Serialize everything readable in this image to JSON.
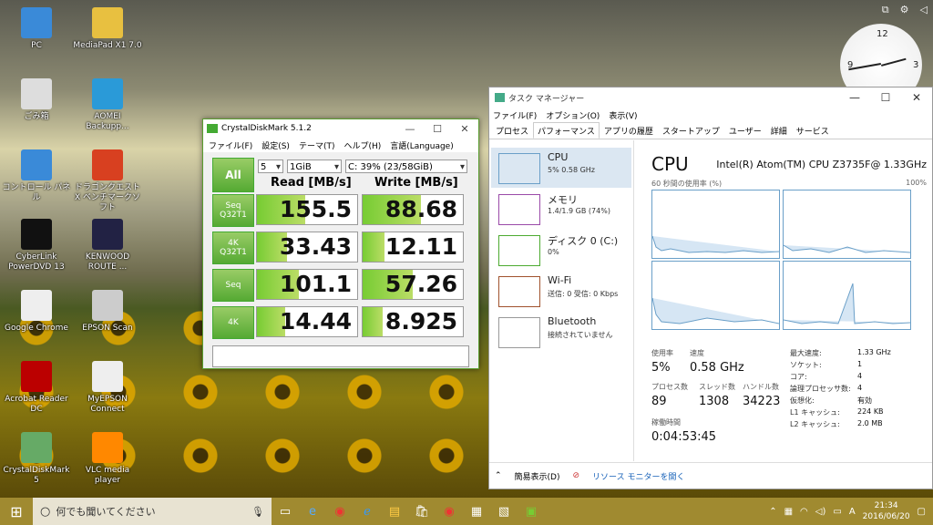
{
  "desktop": {
    "icons": [
      {
        "label": "PC",
        "icon": "computer-icon"
      },
      {
        "label": "MediaPad X1 7.0",
        "icon": "folder-icon"
      },
      {
        "label": "ごみ箱",
        "icon": "recycle-bin-icon"
      },
      {
        "label": "AOMEI Backupp...",
        "icon": "aomei-icon"
      },
      {
        "label": "コントロール パネル",
        "icon": "control-panel-icon"
      },
      {
        "label": "ドラゴンクエストX ベンチマークソフト",
        "icon": "dq-icon"
      },
      {
        "label": "CyberLink PowerDVD 13",
        "icon": "powerdvd-icon"
      },
      {
        "label": "KENWOOD ROUTE ...",
        "icon": "kenwood-icon"
      },
      {
        "label": "Google Chrome",
        "icon": "chrome-icon"
      },
      {
        "label": "EPSON Scan",
        "icon": "scanner-icon"
      },
      {
        "label": "Acrobat Reader DC",
        "icon": "acrobat-icon"
      },
      {
        "label": "MyEPSON Connect",
        "icon": "epson-connect-icon"
      },
      {
        "label": "CrystalDiskMark 5",
        "icon": "cdm-icon"
      },
      {
        "label": "VLC media player",
        "icon": "vlc-icon"
      }
    ]
  },
  "cdm": {
    "title": "CrystalDiskMark 5.1.2",
    "menu": [
      "ファイル(F)",
      "設定(S)",
      "テーマ(T)",
      "ヘルプ(H)",
      "言語(Language)"
    ],
    "all_label": "All",
    "count": "5",
    "size": "1GiB",
    "drive": "C: 39% (23/58GiB)",
    "read_header": "Read [MB/s]",
    "write_header": "Write [MB/s]",
    "rows": [
      {
        "l1": "Seq",
        "l2": "Q32T1",
        "read": "155.5",
        "write": "88.68",
        "read_fill": 0.48,
        "write_fill": 0.58
      },
      {
        "l1": "4K",
        "l2": "Q32T1",
        "read": "33.43",
        "write": "12.11",
        "read_fill": 0.3,
        "write_fill": 0.22
      },
      {
        "l1": "Seq",
        "l2": "",
        "read": "101.1",
        "write": "57.26",
        "read_fill": 0.42,
        "write_fill": 0.5
      },
      {
        "l1": "4K",
        "l2": "",
        "read": "14.44",
        "write": "8.925",
        "read_fill": 0.28,
        "write_fill": 0.2
      }
    ],
    "comment": ""
  },
  "taskmgr": {
    "title": "タスク マネージャー",
    "menu": [
      "ファイル(F)",
      "オプション(O)",
      "表示(V)"
    ],
    "tabs": [
      "プロセス",
      "パフォーマンス",
      "アプリの履歴",
      "スタートアップ",
      "ユーザー",
      "詳細",
      "サービス"
    ],
    "active_tab": 1,
    "side": [
      {
        "name": "CPU",
        "sub": "5%  0.58 GHz",
        "color": "#6a9fc8"
      },
      {
        "name": "メモリ",
        "sub": "1.4/1.9 GB (74%)",
        "color": "#9a4aa8"
      },
      {
        "name": "ディスク 0 (C:)",
        "sub": "0%",
        "color": "#4caa30"
      },
      {
        "name": "Wi-Fi",
        "sub": "送信: 0  受信: 0 Kbps",
        "color": "#a0522d"
      },
      {
        "name": "Bluetooth",
        "sub": "接続されていません",
        "color": "#999999"
      }
    ],
    "cpu_heading": "CPU",
    "cpu_name": "Intel(R) Atom(TM) CPU Z3735F@ 1.33GHz",
    "graph_label": "60 秒間の使用率 (%)",
    "graph_max": "100%",
    "stats": {
      "usage_label": "使用率",
      "usage": "5%",
      "speed_label": "速度",
      "speed": "0.58 GHz",
      "proc_label": "プロセス数",
      "proc": "89",
      "thread_label": "スレッド数",
      "thread": "1308",
      "handle_label": "ハンドル数",
      "handle": "34223",
      "uptime_label": "稼働時間",
      "uptime": "0:04:53:45"
    },
    "details": [
      {
        "k": "最大速度:",
        "v": "1.33 GHz"
      },
      {
        "k": "ソケット:",
        "v": "1"
      },
      {
        "k": "コア:",
        "v": "4"
      },
      {
        "k": "論理プロセッサ数:",
        "v": "4"
      },
      {
        "k": "仮想化:",
        "v": "有効"
      },
      {
        "k": "L1 キャッシュ:",
        "v": "224 KB"
      },
      {
        "k": "L2 キャッシュ:",
        "v": "2.0 MB"
      }
    ],
    "footer_simple": "簡易表示(D)",
    "footer_monitor": "リソース モニターを開く"
  },
  "taskbar": {
    "search_placeholder": "何でも聞いてください",
    "time": "21:34",
    "date": "2016/06/20"
  }
}
